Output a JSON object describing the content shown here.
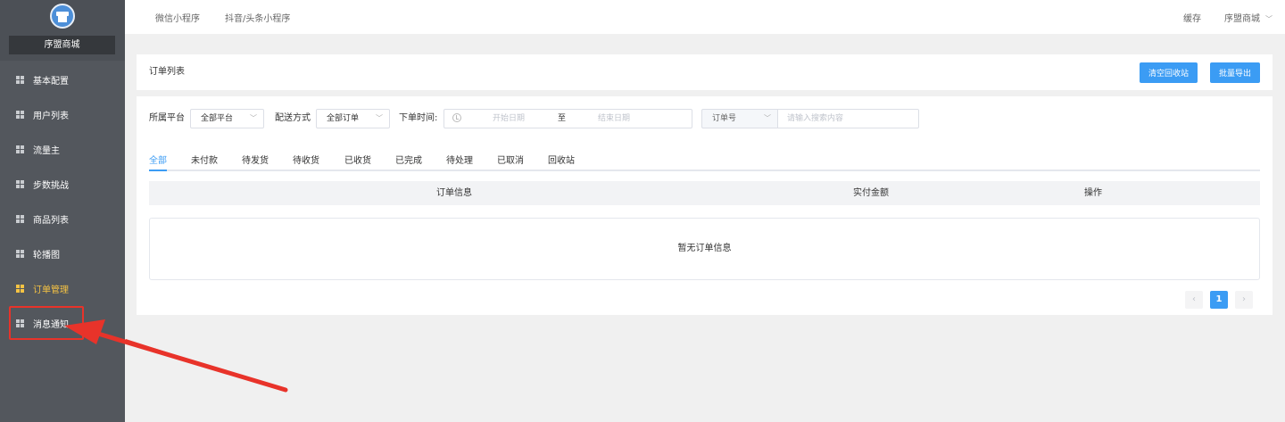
{
  "sidebar": {
    "store_name": "序盟商城",
    "items": [
      {
        "label": "基本配置"
      },
      {
        "label": "用户列表"
      },
      {
        "label": "流量主"
      },
      {
        "label": "步数挑战"
      },
      {
        "label": "商品列表"
      },
      {
        "label": "轮播图"
      },
      {
        "label": "订单管理",
        "active": true
      },
      {
        "label": "消息通知"
      }
    ]
  },
  "topbar": {
    "nav": [
      "微信小程序",
      "抖音/头条小程序"
    ],
    "cache": "缓存",
    "user": "序盟商城",
    "user_chevron": "﹀"
  },
  "header": {
    "title": "订单列表",
    "btn_clear_recycle": "清空回收站",
    "btn_batch_export": "批量导出"
  },
  "filters": {
    "platform_label": "所属平台",
    "platform_value": "全部平台",
    "delivery_label": "配送方式",
    "delivery_value": "全部订单",
    "time_label": "下单时间:",
    "start_placeholder": "开始日期",
    "range_sep": "至",
    "end_placeholder": "结束日期",
    "search_type": "订单号",
    "search_placeholder": "请输入搜索内容"
  },
  "tabs": [
    "全部",
    "未付款",
    "待发货",
    "待收货",
    "已收货",
    "已完成",
    "待处理",
    "已取消",
    "回收站"
  ],
  "table": {
    "col_order_info": "订单信息",
    "col_paid": "实付金额",
    "col_action": "操作",
    "empty_text": "暂无订单信息"
  },
  "pagination": {
    "prev": "‹",
    "current": "1",
    "next": "›"
  },
  "colors": {
    "sidebar_bg": "#53575d",
    "accent": "#3b9cf4",
    "active_menu": "#f6c343",
    "annotation": "#e8332a"
  }
}
